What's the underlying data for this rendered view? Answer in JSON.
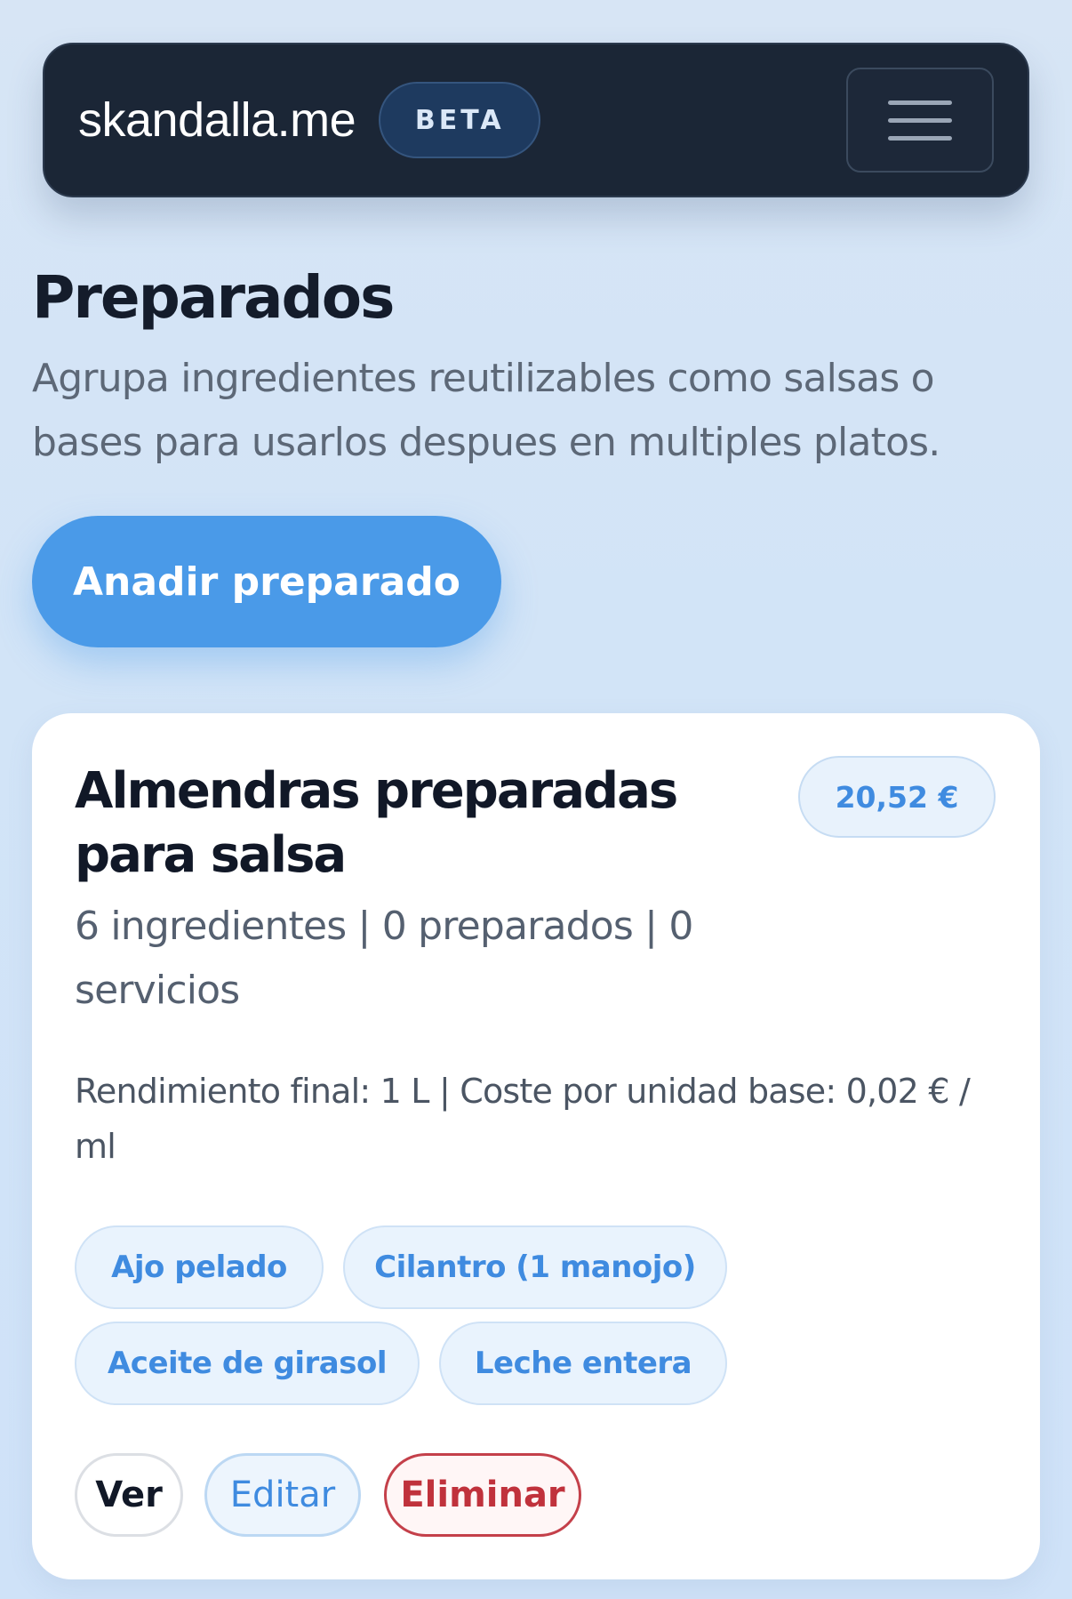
{
  "header": {
    "brand": "skandalla.me",
    "badge": "BETA",
    "menu_icon": "hamburger-menu-icon"
  },
  "page": {
    "title": "Preparados",
    "description": "Agrupa ingredientes reutilizables como salsas o bases para usarlos despues en multiples platos.",
    "add_button_label": "Anadir preparado"
  },
  "card": {
    "title": "Almendras preparadas para salsa",
    "price": "20,52 €",
    "meta": "6 ingredientes | 0 preparados | 0 servicios",
    "yield": "Rendimiento final: 1 L | Coste por unidad base: 0,02 € / ml",
    "ingredients": [
      "Ajo pelado",
      "Cilantro (1 manojo)",
      "Aceite de girasol",
      "Leche entera"
    ],
    "actions": {
      "view": "Ver",
      "edit": "Editar",
      "delete": "Eliminar"
    }
  },
  "colors": {
    "accent": "#4a9ae8",
    "header_bg": "#1b2636",
    "danger": "#c0323c",
    "chip_text": "#3f8be0"
  }
}
